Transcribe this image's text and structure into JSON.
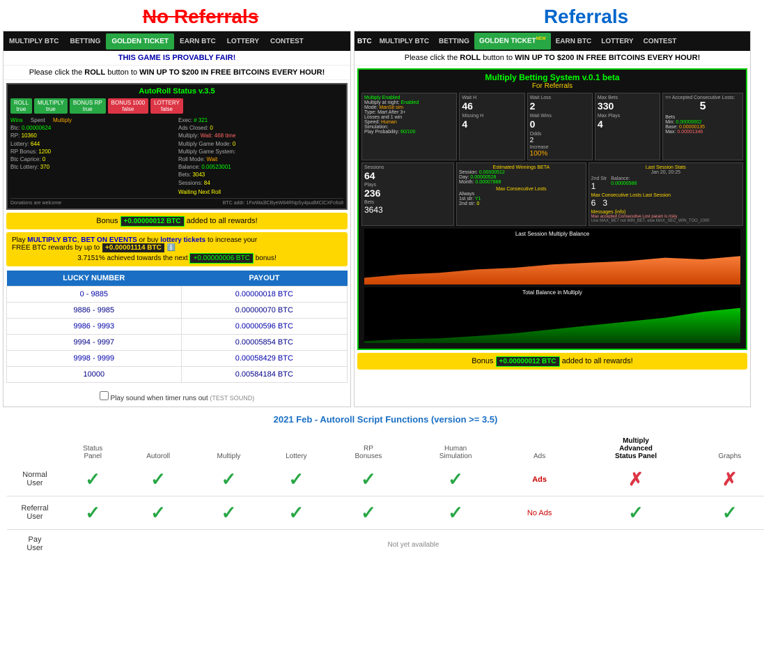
{
  "headings": {
    "no_referrals": "No Referrals",
    "referrals": "Referrals"
  },
  "nav": {
    "items": [
      "MULTIPLY BTC",
      "BETTING",
      "GOLDEN TICKET",
      "EARN BTC",
      "LOTTERY",
      "CONTEST"
    ],
    "active": "GOLDEN TICKET"
  },
  "left_panel": {
    "provably_fair": "THIS GAME IS PROVABLY FAIR!",
    "free_btc_msg": "Please click the ROLL button to WIN UP TO $200 IN FREE BITCOINS EVERY HOUR!",
    "autoroll": {
      "title": "AutoRoll Status v.3.5",
      "buttons": [
        {
          "label": "ROLL",
          "state": "true",
          "type": "green"
        },
        {
          "label": "MULTIPLY",
          "state": "true",
          "type": "green"
        },
        {
          "label": "BONUS RP",
          "state": "true",
          "type": "green"
        },
        {
          "label": "BONUS 1000",
          "state": "false",
          "type": "red"
        },
        {
          "label": "LOTTERY",
          "state": "false",
          "type": "red"
        }
      ],
      "exec_label": "Exec:",
      "exec_val": "# 321",
      "ads_label": "Ads Closed:",
      "ads_val": "0",
      "multiply_label": "Multiply:",
      "multiply_val": "Wait: 468 time",
      "multiply_game_mode": "Multiply Game Mode: 0",
      "multiply_game_sys": "Multiply Game System:",
      "roll_mode": "Roll Mode: Wait",
      "wins_label": "Wins",
      "spent_label": "Spent",
      "multiply_label2": "Multiply",
      "btc_val": "Btc: 0.00000624",
      "rp_val": "RP: 10360",
      "lottery_val": "Lottery: 644",
      "rp_bonus": "RP Bonus: 1200",
      "btc_caprice": "Btc Caprice: 0",
      "btc_lottery": "Btc Lottery: 370",
      "balance": "Balance: 0.00523001",
      "bets": "Bets: 3043",
      "sessions": "Sessions: 84",
      "waiting": "Waiting Next Roll",
      "wallet": "Donations are welcome",
      "addr": "BTC addr: 1FwWa3lCByeW84RNpSy4pudMClCXFc6s8"
    },
    "bonus": {
      "label": "Bonus",
      "amount": "+0.00000012 BTC",
      "suffix": "added to all rewards!"
    },
    "promo": {
      "line1_prefix": "Play",
      "multiply": "MULTIPLY BTC",
      "comma": ",",
      "bet": "BET ON EVENTS",
      "or": "or buy",
      "lottery": "lottery tickets",
      "line1_suffix": "to increase your",
      "line2_prefix": "FREE BTC rewards by up to",
      "free_amount": "+0.00001114 BTC",
      "progress_text": "3.7151% achieved towards the next",
      "progress_amount": "+0.00000006 BTC",
      "progress_suffix": "bonus!"
    },
    "table": {
      "col1": "LUCKY NUMBER",
      "col2": "PAYOUT",
      "rows": [
        {
          "range": "0 - 9885",
          "payout": "0.00000018 BTC"
        },
        {
          "range": "9886 - 9985",
          "payout": "0.00000070 BTC"
        },
        {
          "range": "9986 - 9993",
          "payout": "0.00000596 BTC"
        },
        {
          "range": "9994 - 9997",
          "payout": "0.00005854 BTC"
        },
        {
          "range": "9998 - 9999",
          "payout": "0.00058429 BTC"
        },
        {
          "range": "10000",
          "payout": "0.00584184 BTC"
        }
      ]
    },
    "sound": {
      "label": "Play sound when timer runs out",
      "test": "(TEST SOUND)"
    }
  },
  "right_panel": {
    "nav_items": [
      "BTC",
      "MULTIPLY BTC",
      "BETTING",
      "GOLDEN TICKET",
      "EARN BTC",
      "LOTTERY",
      "CONTEST"
    ],
    "golden_new": "NEW",
    "free_btc_msg": "Please click the ROLL button to WIN UP TO $200 IN FREE BITCOINS EVERY HOUR!",
    "multiply": {
      "title": "Multiply Betting System v.0.1 beta",
      "subtitle": "For Referrals",
      "enabled_label": "Multiply Enabled",
      "night_label": "Multiply at night: Enabled",
      "mode_label": "Mode: ManSit sim",
      "type_label": "Type: Mart After 3+",
      "losses_label": "Losses and 1 win",
      "speed_label": "Speed: Human",
      "simulation_label": "Simulation:",
      "prob_label": "Play Probability: 60/100",
      "wait_h_label": "Wait H",
      "wait_h_val": "46",
      "missing_h_label": "Missing H",
      "missing_h_val": "4",
      "wait_loss_label": "Wait Loss",
      "wait_loss_val": "2",
      "wait_wins_label": "Wait Wins",
      "wait_wins_val": "0",
      "odds_label": "Odds",
      "odds_val": "2",
      "increase_label": "Increase",
      "increase_val": "100%",
      "max_bets_label": "Max Bets",
      "max_bets_val": "330",
      "max_plays_label": "Max Plays",
      "max_plays_val": "4",
      "accepted_label": "=> Accepted Consecutive Losts:",
      "accepted_val": "5",
      "bets_label": "Bets",
      "min_label": "Min:",
      "min_val": "0.00000002",
      "base_label": "Base:",
      "base_val": "0.00000135",
      "max_label": "Max:",
      "max_val": "0.00001346",
      "sessions_label": "Sessions",
      "sessions_val": "64",
      "plays_label": "Plays",
      "plays_val": "236",
      "bets_count": "3643",
      "estimated_label": "Estimated Winnings BETA",
      "session_label": "Session:",
      "session_val": "0.00000512",
      "day_label": "Day:",
      "day_val": "0.00000528",
      "month_label": "Month:",
      "month_val": "0.00007888",
      "max_consec_label": "Max Consecutive Losts",
      "always_label": "Always",
      "first_str_label": "1st str:",
      "first_str_val": "Y1",
      "second_str_label": "2nd str:",
      "second_str_val": "0",
      "last_session_stats_label": "Last Session Stats",
      "last_session_date": "Jan 20, 20:25",
      "first_str2": "2nd Str",
      "second_str2": "1",
      "balance_label": "Balance:",
      "balance_val": "0.00000588",
      "max_consec2_label": "Max Consecutive Losts Last Session",
      "max_val2": "6",
      "max_val3": "3",
      "messages_label": "Messages (info)",
      "messages_text": "Max accepted Consecutive Lost param is risky",
      "messages_detail": "Use MAX_BET not MIN_BET, else MAX_SEC_WIN_TOO_1000",
      "chart1_label": "Last Session Multiply Balance",
      "chart2_label": "Total Balance in Multiply"
    },
    "bonus": {
      "label": "Bonus",
      "amount": "+0.00000012 BTC",
      "suffix": "added to all rewards!"
    }
  },
  "comparison": {
    "title": "2021 Feb - Autoroll Script Functions (version >= 3.5)",
    "columns": [
      {
        "label": "Status\nPanel",
        "bold": false
      },
      {
        "label": "Autoroll",
        "bold": false
      },
      {
        "label": "Multiply",
        "bold": false
      },
      {
        "label": "Lottery",
        "bold": false
      },
      {
        "label": "RP\nBonuses",
        "bold": false
      },
      {
        "label": "Human\nSimulation",
        "bold": false
      },
      {
        "label": "Ads",
        "bold": false
      },
      {
        "label": "Multiply\nAdvanced\nStatus Panel",
        "bold": true
      },
      {
        "label": "Graphs",
        "bold": false
      }
    ],
    "rows": [
      {
        "label": "Normal User",
        "label_bold": false,
        "checks": [
          "check",
          "check",
          "check",
          "check",
          "check",
          "check",
          "ads",
          "cross",
          "cross"
        ]
      },
      {
        "label": "Referral User",
        "label_bold": false,
        "checks": [
          "check",
          "check",
          "check",
          "check",
          "check",
          "check",
          "no-ads",
          "check",
          "check"
        ]
      },
      {
        "label": "Pay User",
        "label_bold": false,
        "checks": [
          "not-available",
          "not-available",
          "not-available",
          "not-available",
          "not-available",
          "not-available",
          "not-available",
          "not-available",
          "not-available"
        ]
      }
    ],
    "not_yet_available": "Not yet available",
    "ads_label": "Ads",
    "no_ads_label": "No Ads"
  }
}
